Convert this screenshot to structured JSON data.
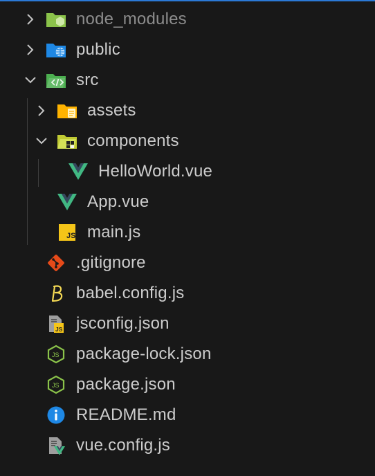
{
  "explorer": {
    "items": [
      {
        "name": "node_modules",
        "kind": "folder",
        "state": "collapsed",
        "icon": "node-modules-folder-icon"
      },
      {
        "name": "public",
        "kind": "folder",
        "state": "collapsed",
        "icon": "public-folder-icon"
      },
      {
        "name": "src",
        "kind": "folder",
        "state": "expanded",
        "icon": "src-folder-icon"
      },
      {
        "name": "assets",
        "kind": "folder",
        "state": "collapsed",
        "icon": "assets-folder-icon"
      },
      {
        "name": "components",
        "kind": "folder",
        "state": "expanded",
        "icon": "components-folder-icon"
      },
      {
        "name": "HelloWorld.vue",
        "kind": "file",
        "icon": "vue-icon"
      },
      {
        "name": "App.vue",
        "kind": "file",
        "icon": "vue-icon"
      },
      {
        "name": "main.js",
        "kind": "file",
        "icon": "javascript-icon"
      },
      {
        "name": ".gitignore",
        "kind": "file",
        "icon": "git-icon"
      },
      {
        "name": "babel.config.js",
        "kind": "file",
        "icon": "babel-icon"
      },
      {
        "name": "jsconfig.json",
        "kind": "file",
        "icon": "jsconfig-icon"
      },
      {
        "name": "package-lock.json",
        "kind": "file",
        "icon": "nodejs-icon"
      },
      {
        "name": "package.json",
        "kind": "file",
        "icon": "nodejs-icon"
      },
      {
        "name": "README.md",
        "kind": "file",
        "icon": "info-icon"
      },
      {
        "name": "vue.config.js",
        "kind": "file",
        "icon": "vue-config-icon"
      }
    ]
  },
  "colors": {
    "background": "#181818",
    "text": "#cccccc",
    "dim_text": "#8c8c8c",
    "accent": "#2b79d6",
    "vue_green": "#41b883",
    "js_yellow": "#f5c518"
  }
}
